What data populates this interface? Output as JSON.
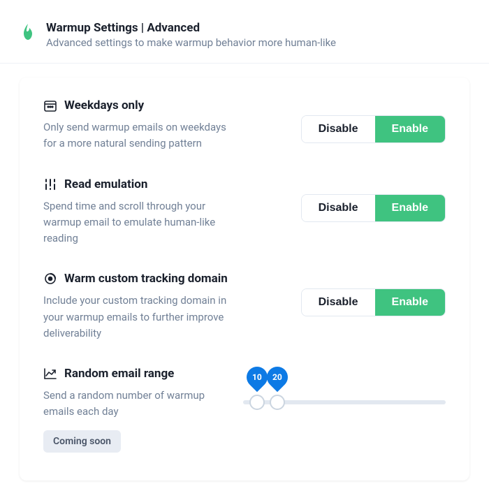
{
  "header": {
    "title": "Warmup Settings | Advanced",
    "subtitle": "Advanced settings to make warmup behavior more human-like"
  },
  "toggle": {
    "disable": "Disable",
    "enable": "Enable"
  },
  "settings": {
    "weekdays": {
      "title": "Weekdays only",
      "desc": "Only send warmup emails on weekdays for a more natural sending pattern",
      "enabled": true
    },
    "read": {
      "title": "Read emulation",
      "desc": "Spend time and scroll through your warmup email to emulate human-like reading",
      "enabled": true
    },
    "tracking": {
      "title": "Warm custom tracking domain",
      "desc": "Include your custom tracking domain in your warmup emails to further improve deliverability",
      "enabled": true
    },
    "random": {
      "title": "Random email range",
      "desc": "Send a random number of warmup emails each day",
      "badge": "Coming soon",
      "min": "10",
      "max": "20"
    }
  }
}
